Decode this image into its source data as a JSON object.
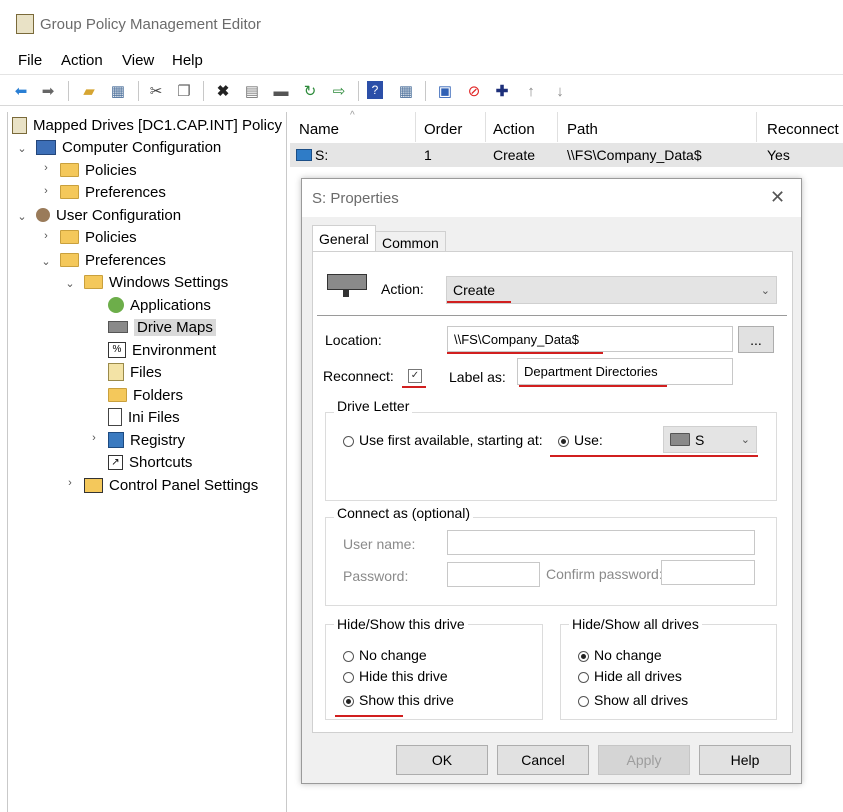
{
  "window": {
    "title": "Group Policy Management Editor"
  },
  "menu": [
    "File",
    "Action",
    "View",
    "Help"
  ],
  "toolbar": [
    "back-icon",
    "forward-icon",
    "up-folder-icon",
    "show-hide-tree-icon",
    "cut-icon",
    "copy-icon",
    "delete-icon",
    "properties-icon",
    "print-icon",
    "refresh-icon",
    "export-icon",
    "help-icon",
    "view-icon",
    "new-item-icon",
    "stop-icon",
    "add-icon",
    "move-up-icon",
    "move-down-icon"
  ],
  "tree": {
    "root": "Mapped Drives [DC1.CAP.INT] Policy",
    "computer_config": "Computer Configuration",
    "cc_policies": "Policies",
    "cc_preferences": "Preferences",
    "user_config": "User Configuration",
    "uc_policies": "Policies",
    "uc_preferences": "Preferences",
    "windows_settings": "Windows Settings",
    "applications": "Applications",
    "drive_maps": "Drive Maps",
    "environment": "Environment",
    "files": "Files",
    "folders": "Folders",
    "ini_files": "Ini Files",
    "registry": "Registry",
    "shortcuts": "Shortcuts",
    "control_panel": "Control Panel Settings"
  },
  "list": {
    "columns": [
      "Name",
      "Order",
      "Action",
      "Path",
      "Reconnect"
    ],
    "rows": [
      {
        "name": "S:",
        "order": "1",
        "action": "Create",
        "path": "\\\\FS\\Company_Data$",
        "reconnect": "Yes"
      }
    ]
  },
  "dialog": {
    "title": "S: Properties",
    "tabs": [
      "General",
      "Common"
    ],
    "action_label": "Action:",
    "action_value": "Create",
    "location_label": "Location:",
    "location_value": "\\\\FS\\Company_Data$",
    "browse_label": "...",
    "reconnect_label": "Reconnect:",
    "label_as_label": "Label as:",
    "label_as_value": "Department Directories",
    "drive_letter_group": "Drive Letter",
    "use_first_available": "Use first available, starting at:",
    "use_label": "Use:",
    "use_value": "S",
    "connect_as_group": "Connect as (optional)",
    "username_label": "User name:",
    "password_label": "Password:",
    "confirm_password_label": "Confirm password:",
    "hide_show_drive_group": "Hide/Show this drive",
    "hsd_options": [
      "No change",
      "Hide this drive",
      "Show this drive"
    ],
    "hide_show_all_group": "Hide/Show all drives",
    "hsa_options": [
      "No change",
      "Hide all drives",
      "Show all drives"
    ],
    "buttons": {
      "ok": "OK",
      "cancel": "Cancel",
      "apply": "Apply",
      "help": "Help"
    }
  }
}
